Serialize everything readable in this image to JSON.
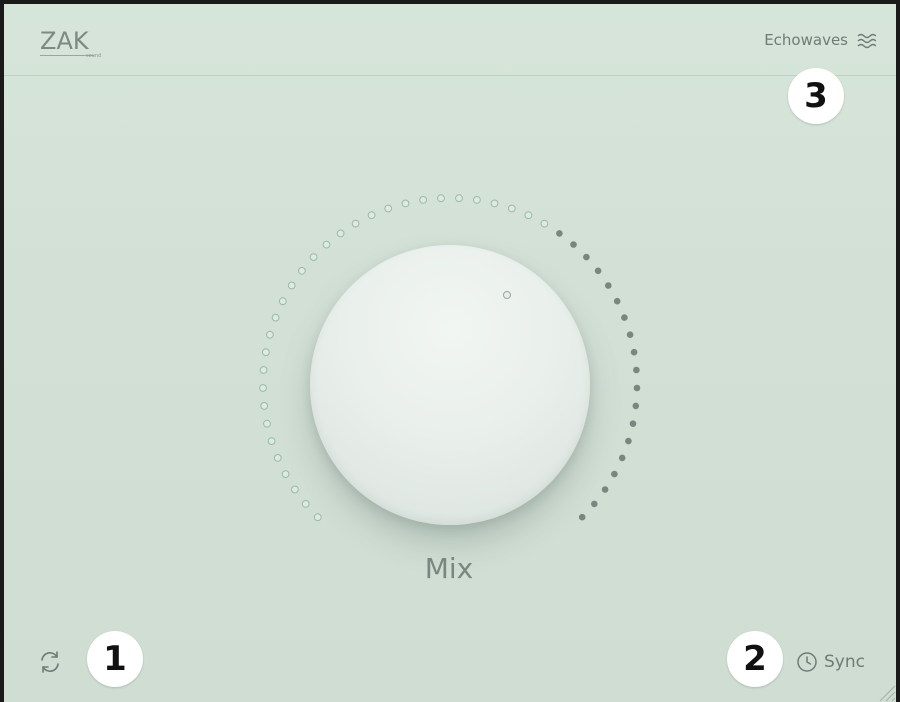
{
  "logo": {
    "text": "ZAK",
    "subtext": "sound"
  },
  "header": {
    "product_name": "Echowaves",
    "menu_icon": "waves-icon"
  },
  "knob": {
    "label": "Mix",
    "value": 0.62
  },
  "footer": {
    "reset_icon": "refresh-icon",
    "sync_label": "Sync",
    "sync_icon": "clock-icon"
  },
  "annotations": [
    "1",
    "2",
    "3"
  ],
  "colors": {
    "background": "#d6e5da",
    "dot_active": "#7a8680",
    "dot_inactive": "#d9ecdf",
    "text": "#6f7c75"
  }
}
